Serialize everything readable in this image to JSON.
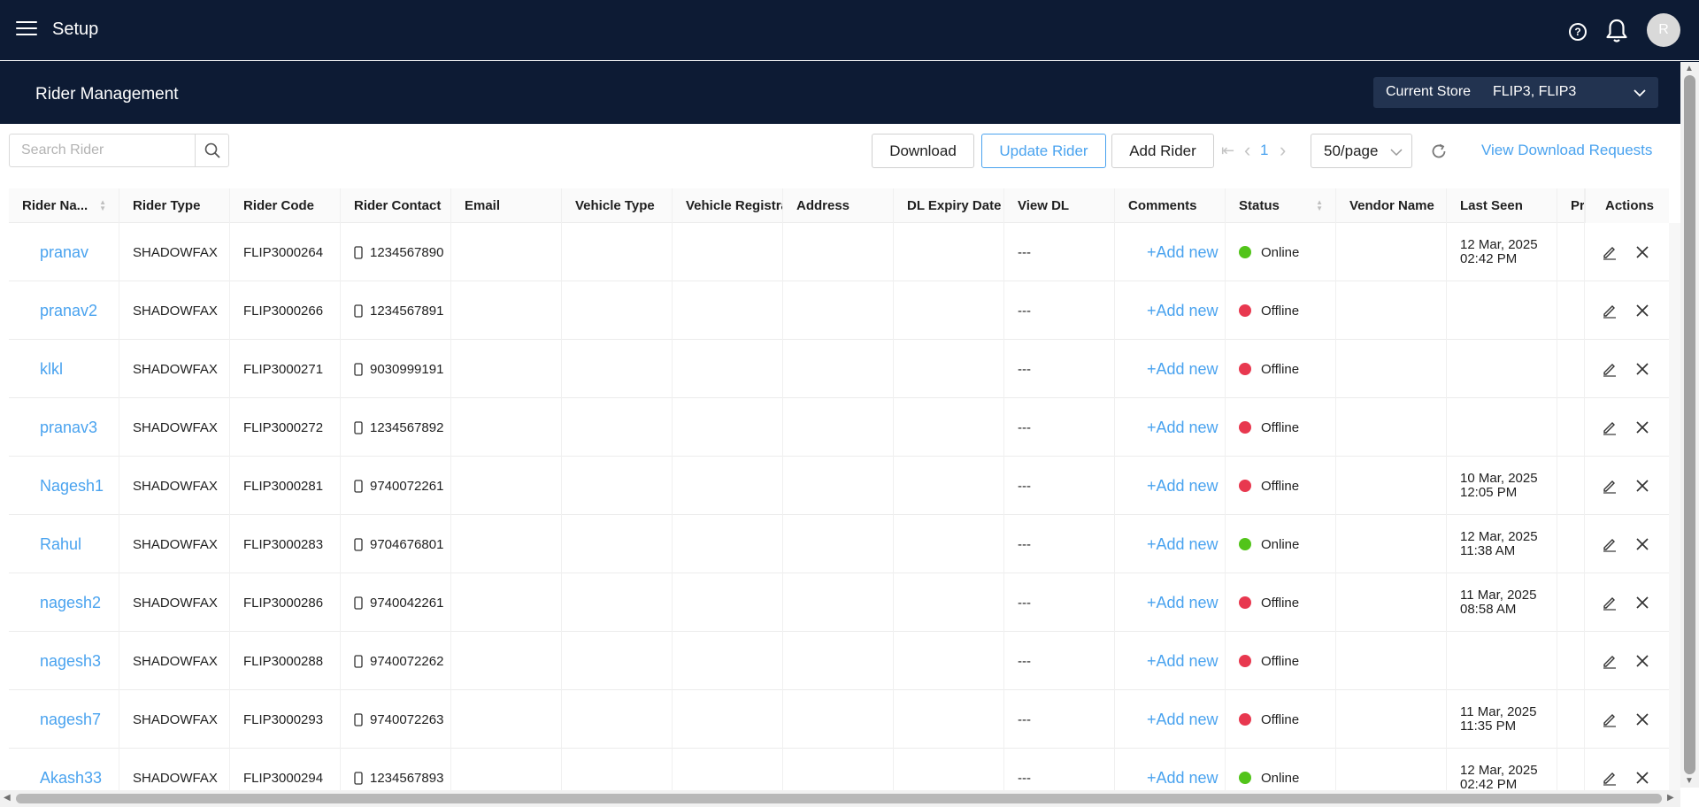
{
  "topbar": {
    "title": "Setup",
    "help_glyph": "?",
    "avatar_initial": "R"
  },
  "subheader": {
    "page_title": "Rider Management",
    "store_label": "Current Store",
    "store_value": "FLIP3, FLIP3"
  },
  "toolbar": {
    "search_placeholder": "Search Rider",
    "download_label": "Download",
    "update_label": "Update Rider",
    "add_label": "Add Rider",
    "first_glyph": "⇤",
    "prev_glyph": "‹",
    "page": "1",
    "next_glyph": "›",
    "page_size": "50/page",
    "view_requests_label": "View Download Requests"
  },
  "table": {
    "columns": [
      "Rider Na...",
      "Rider Type",
      "Rider Code",
      "Rider Contact",
      "Email",
      "Vehicle Type",
      "Vehicle Registrat",
      "Address",
      "DL Expiry Date",
      "View DL",
      "Comments",
      "Status",
      "Vendor Name",
      "Last Seen",
      "Pr",
      "Actions"
    ],
    "rows": [
      {
        "name": "pranav",
        "type": "SHADOWFAX",
        "code": "FLIP3000264",
        "contact": "1234567890",
        "dl": "---",
        "comment": "+Add new",
        "status": "Online",
        "last_seen_date": "12 Mar, 2025",
        "last_seen_time": "02:42 PM"
      },
      {
        "name": "pranav2",
        "type": "SHADOWFAX",
        "code": "FLIP3000266",
        "contact": "1234567891",
        "dl": "---",
        "comment": "+Add new",
        "status": "Offline",
        "last_seen_date": "",
        "last_seen_time": ""
      },
      {
        "name": "klkl",
        "type": "SHADOWFAX",
        "code": "FLIP3000271",
        "contact": "9030999191",
        "dl": "---",
        "comment": "+Add new",
        "status": "Offline",
        "last_seen_date": "",
        "last_seen_time": ""
      },
      {
        "name": "pranav3",
        "type": "SHADOWFAX",
        "code": "FLIP3000272",
        "contact": "1234567892",
        "dl": "---",
        "comment": "+Add new",
        "status": "Offline",
        "last_seen_date": "",
        "last_seen_time": ""
      },
      {
        "name": "Nagesh1",
        "type": "SHADOWFAX",
        "code": "FLIP3000281",
        "contact": "9740072261",
        "dl": "---",
        "comment": "+Add new",
        "status": "Offline",
        "last_seen_date": "10 Mar, 2025",
        "last_seen_time": "12:05 PM"
      },
      {
        "name": "Rahul",
        "type": "SHADOWFAX",
        "code": "FLIP3000283",
        "contact": "9704676801",
        "dl": "---",
        "comment": "+Add new",
        "status": "Online",
        "last_seen_date": "12 Mar, 2025",
        "last_seen_time": "11:38 AM"
      },
      {
        "name": "nagesh2",
        "type": "SHADOWFAX",
        "code": "FLIP3000286",
        "contact": "9740042261",
        "dl": "---",
        "comment": "+Add new",
        "status": "Offline",
        "last_seen_date": "11 Mar, 2025",
        "last_seen_time": "08:58 AM"
      },
      {
        "name": "nagesh3",
        "type": "SHADOWFAX",
        "code": "FLIP3000288",
        "contact": "9740072262",
        "dl": "---",
        "comment": "+Add new",
        "status": "Offline",
        "last_seen_date": "",
        "last_seen_time": ""
      },
      {
        "name": "nagesh7",
        "type": "SHADOWFAX",
        "code": "FLIP3000293",
        "contact": "9740072263",
        "dl": "---",
        "comment": "+Add new",
        "status": "Offline",
        "last_seen_date": "11 Mar, 2025",
        "last_seen_time": "11:35 PM"
      },
      {
        "name": "Akash33",
        "type": "SHADOWFAX",
        "code": "FLIP3000294",
        "contact": "1234567893",
        "dl": "---",
        "comment": "+Add new",
        "status": "Online",
        "last_seen_date": "12 Mar, 2025",
        "last_seen_time": "02:42 PM"
      }
    ]
  },
  "colors": {
    "header_bg": "#0d1b34",
    "accent": "#4aa3ef",
    "online": "#52c41a",
    "offline": "#e8384f"
  },
  "icons": [
    "menu-icon",
    "help-icon",
    "bell-icon",
    "avatar",
    "chevron-down-icon",
    "search-icon",
    "refresh-icon",
    "phone-icon",
    "edit-icon",
    "close-icon"
  ]
}
